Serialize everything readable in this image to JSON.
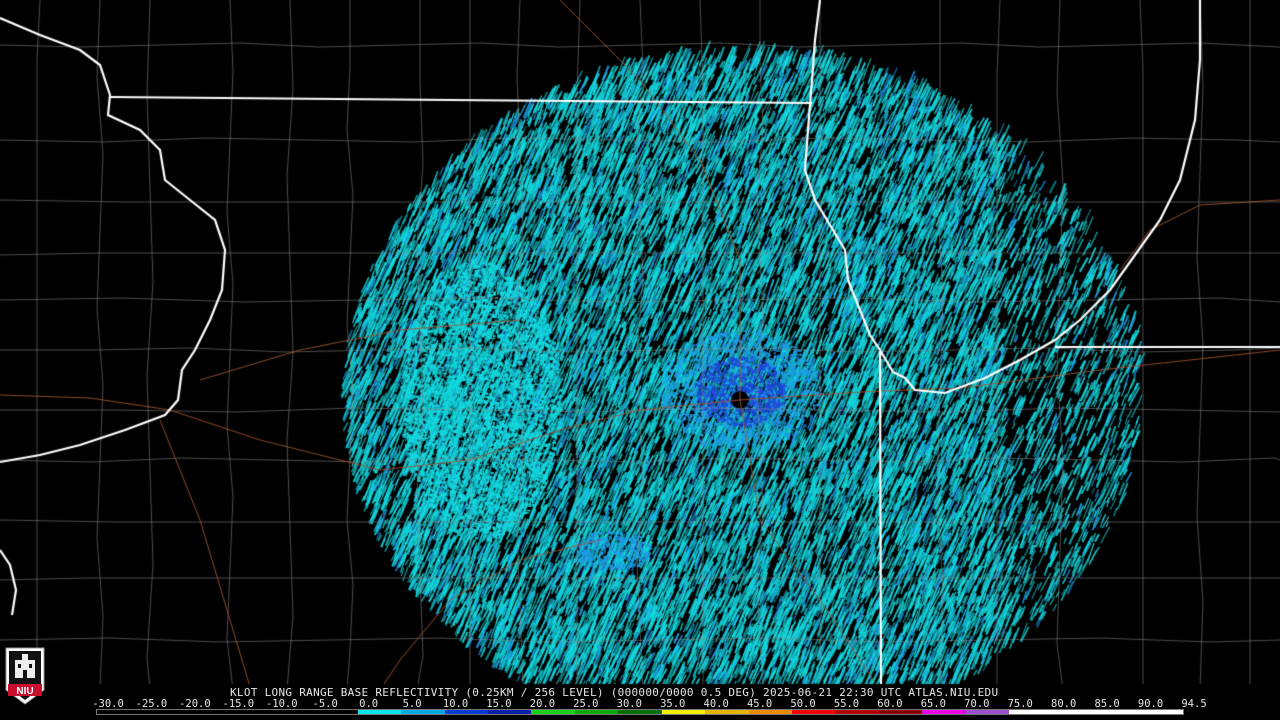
{
  "caption": "KLOT LONG RANGE BASE REFLECTIVITY (0.25KM / 256 LEVEL) (000000/0000 0.5 DEG) 2025-06-21 22:30 UTC  ATLAS.NIU.EDU",
  "legend": {
    "ticks": [
      "-30.0",
      "-25.0",
      "-20.0",
      "-15.0",
      "-10.0",
      "-5.0",
      "0.0",
      "5.0",
      "10.0",
      "15.0",
      "20.0",
      "25.0",
      "30.0",
      "35.0",
      "40.0",
      "45.0",
      "50.0",
      "55.0",
      "60.0",
      "65.0",
      "70.0",
      "75.0",
      "80.0",
      "85.0",
      "90.0",
      "94.5"
    ],
    "colors": [
      "#000000",
      "#000000",
      "#000000",
      "#000000",
      "#000000",
      "#000000",
      "#06e4ec",
      "#02a9e8",
      "#0a3ad0",
      "#0a1ea8",
      "#16d216",
      "#0aa80a",
      "#066e06",
      "#f0f000",
      "#e6b400",
      "#f08a00",
      "#f00000",
      "#b00000",
      "#8a0000",
      "#f000f0",
      "#9a50d0",
      "#ffffff",
      "#ffffff",
      "#ffffff",
      "#ffffff"
    ]
  },
  "logo": {
    "text": "NIU",
    "color": "#c8102e"
  },
  "map": {
    "background": "#000000",
    "echo_primary": "#14d9e0",
    "echo_secondary": "#1e9ce8",
    "echo_deep": "#1e46d8",
    "county_line": "#8a8a8a",
    "state_line": "#ffffff",
    "road_line": "#a0522d"
  }
}
